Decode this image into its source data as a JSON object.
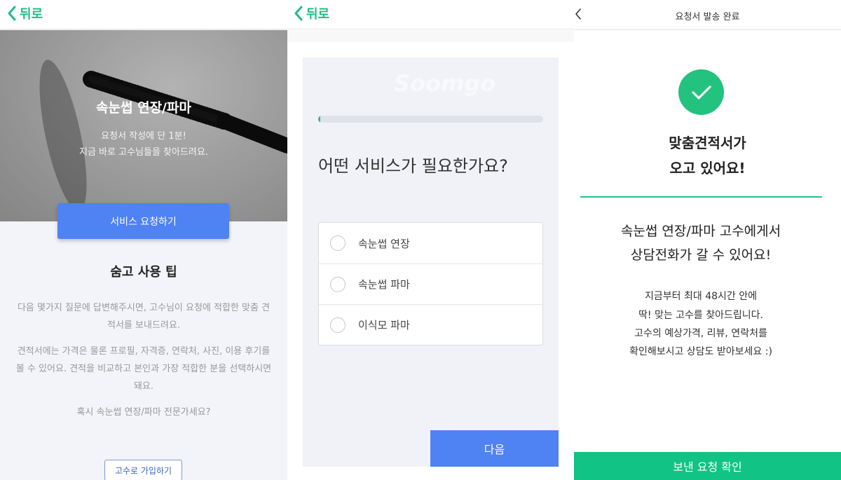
{
  "screen1": {
    "back_label": "뒤로",
    "hero": {
      "title": "속눈썹 연장/파마",
      "subtitle_line1": "요청서 작성에 단 1분!",
      "subtitle_line2": "지금 바로 고수님들을 찾아드려요."
    },
    "request_button": "서비스 요청하기",
    "tips_title": "숨고 사용 팁",
    "tip1": "다음 몇가지 질문에 답변해주시면, 고수님이 요청에 적합한 맞춤 견적서를 보내드려요.",
    "tip2": "견적서에는 가격은 물론 프로필, 자격증, 연락처, 사진, 이용 후기를 볼 수 있어요. 견적을 비교하고 본인과 가장 적합한 분을 선택하시면 돼요.",
    "tip3": "혹시 속눈썹 연장/파마 전문가세요?",
    "join_button": "고수로 가입하기"
  },
  "screen2": {
    "back_label": "뒤로",
    "watermark": "Soomgo",
    "progress_fraction": 0.01,
    "question": "어떤 서비스가 필요한가요?",
    "options": [
      {
        "label": "속눈썹 연장"
      },
      {
        "label": "속눈썹 파마"
      },
      {
        "label": "이식모 파마"
      }
    ],
    "next_button": "다음"
  },
  "screen3": {
    "nav_title": "요청서 발송 완료",
    "done_line1": "맞춤견적서가",
    "done_line2": "오고 있어요!",
    "mid_line1": "속눈썹 연장/파마 고수에게서",
    "mid_line2": "상담전화가 갈 수 있어요!",
    "detail_line1": "지금부터 최대 48시간 안에",
    "detail_line2": "딱! 맞는 고수를 찾아드립니다.",
    "detail_line3": "고수의 예상가격, 리뷰, 연락처를",
    "detail_line4": "확인해보시고 상담도 받아보세요 :)",
    "confirm_button": "보낸 요청 확인"
  },
  "colors": {
    "accent_green": "#1fbe84",
    "primary_blue": "#4f82f2",
    "confirm_green": "#11c384"
  },
  "icons": [
    "chevron-left-icon",
    "mascara-brush-icon",
    "radio-icon",
    "check-icon"
  ]
}
